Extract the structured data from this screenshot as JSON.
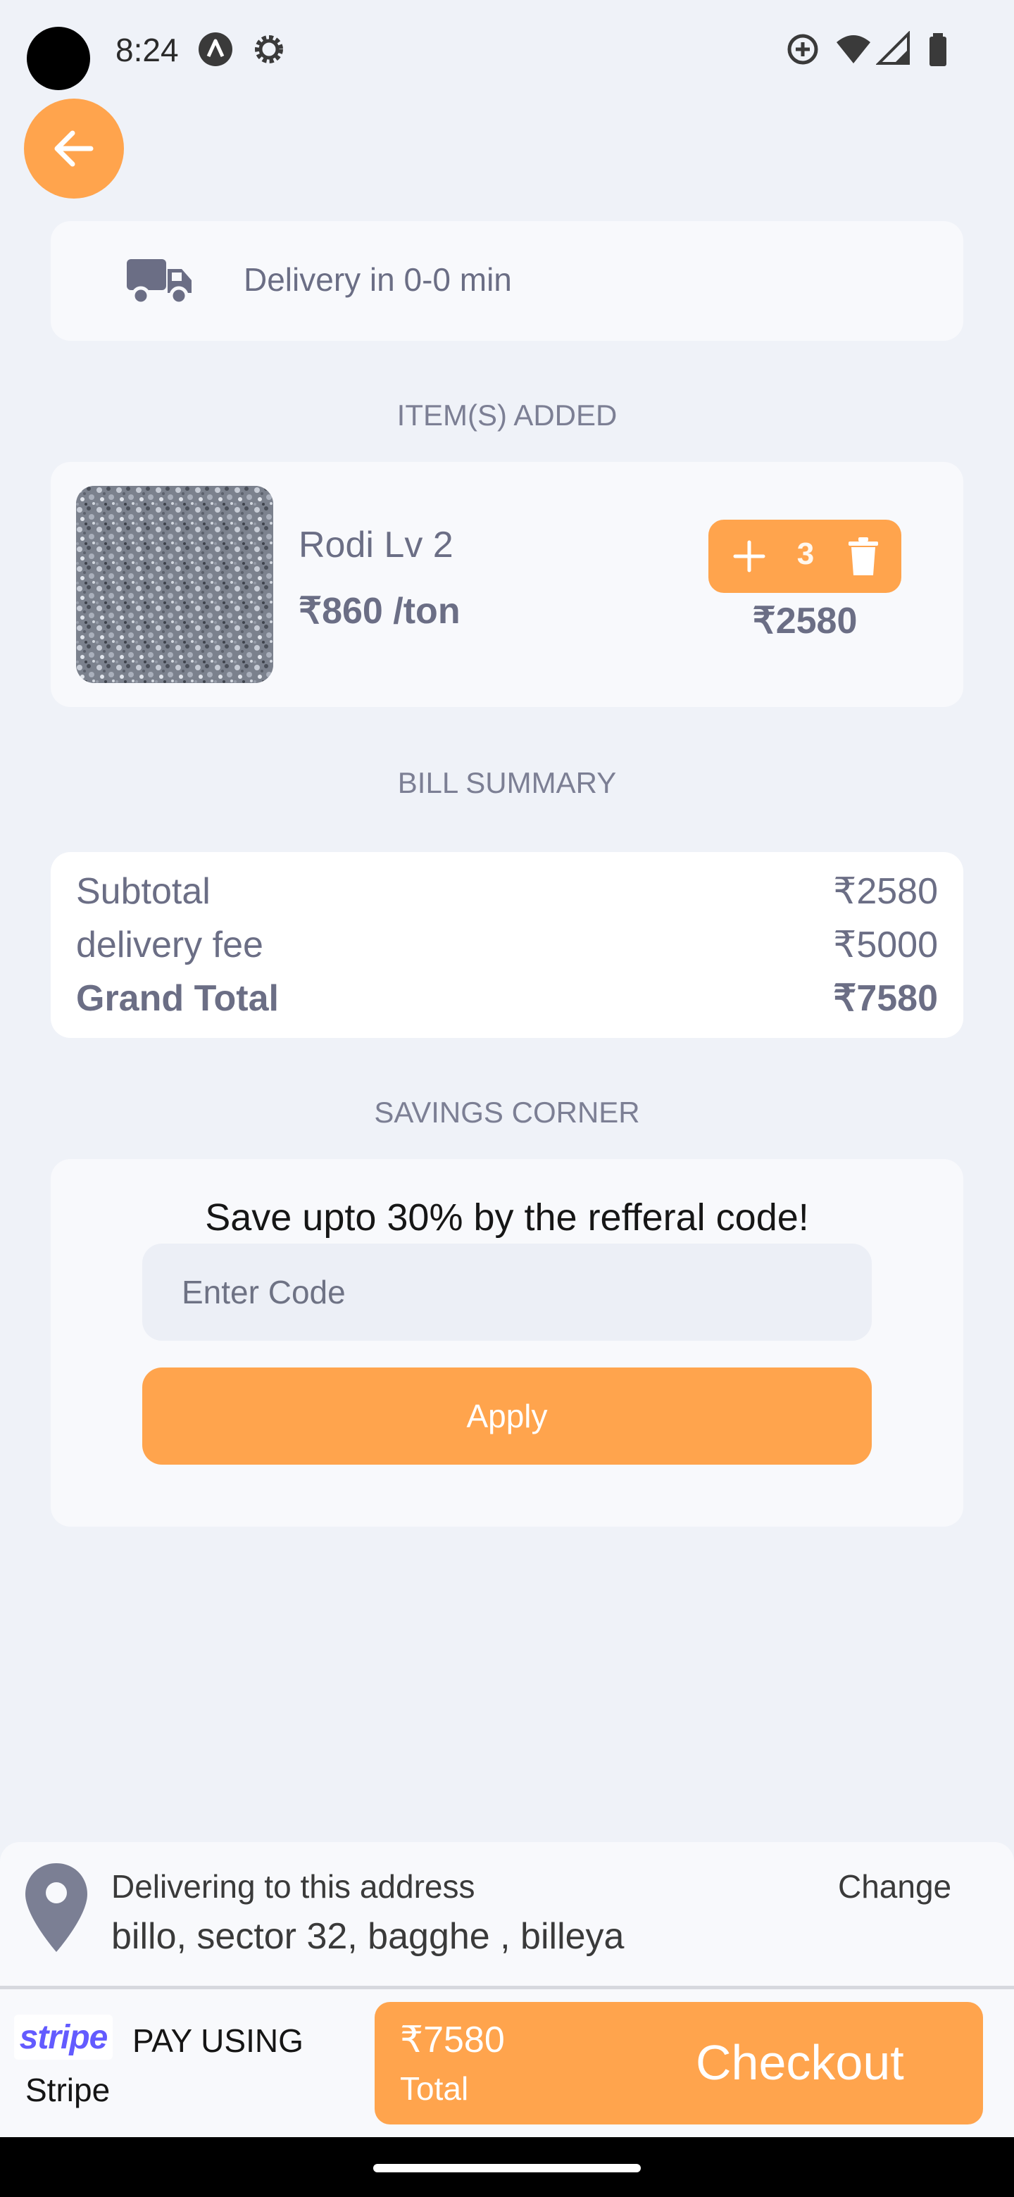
{
  "status_bar": {
    "time": "8:24",
    "icons": [
      "app-a-icon",
      "settings-gear-icon",
      "data-saver-icon",
      "wifi-icon",
      "signal-icon",
      "battery-icon"
    ]
  },
  "header": {
    "back_icon": "arrow-left-icon"
  },
  "delivery": {
    "icon": "truck-icon",
    "text": "Delivery in 0-0 min"
  },
  "items_section": {
    "title": "ITEM(S) ADDED",
    "items": [
      {
        "name": "Rodi Lv 2",
        "price": "₹860 /ton",
        "quantity": "3",
        "total": "₹2580"
      }
    ]
  },
  "bill": {
    "title": "BILL SUMMARY",
    "rows": [
      {
        "label": "Subtotal",
        "value": "₹2580"
      },
      {
        "label": "delivery fee",
        "value": "₹5000"
      },
      {
        "label": "Grand Total",
        "value": "₹7580"
      }
    ]
  },
  "savings": {
    "title": "SAVINGS CORNER",
    "headline": "Save upto 30% by the refferal code!",
    "code_placeholder": "Enter Code",
    "code_value": "",
    "apply_label": "Apply"
  },
  "address": {
    "label": "Delivering to this address",
    "value": "billo, sector 32, bagghe , billeya",
    "change_label": "Change"
  },
  "payment": {
    "logo_text": "stripe",
    "pay_using_label": "PAY USING",
    "provider": "Stripe",
    "amount": "₹7580",
    "total_label": "Total",
    "checkout_label": "Checkout"
  },
  "colors": {
    "accent": "#ffa44d",
    "background": "#eff2f8",
    "card": "#f8f9fc",
    "text": "#6b6e85",
    "stripe": "#635bff"
  }
}
